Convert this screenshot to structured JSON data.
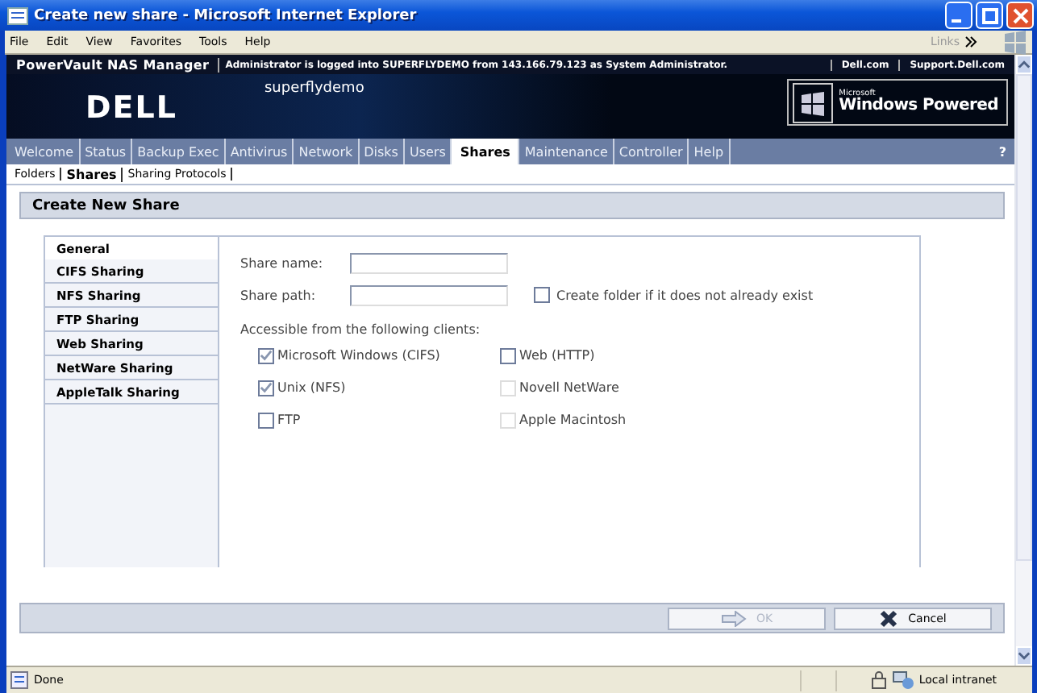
{
  "window": {
    "title": "Create new share - Microsoft Internet Explorer"
  },
  "menu": [
    "File",
    "Edit",
    "View",
    "Favorites",
    "Tools",
    "Help"
  ],
  "links_label": "Links",
  "header": {
    "app_name": "PowerVault NAS Manager",
    "login_message": "Administrator is logged into SUPERFLYDEMO from 143.166.79.123 as System Administrator.",
    "links": [
      "Dell.com",
      "Support.Dell.com"
    ]
  },
  "banner": {
    "logo": "DELL",
    "hostname": "superflydemo",
    "badge_top": "Microsoft",
    "badge_main": "Windows Powered"
  },
  "tabs": [
    {
      "label": "Welcome",
      "selected": false
    },
    {
      "label": "Status",
      "selected": false
    },
    {
      "label": "Backup Exec",
      "selected": false
    },
    {
      "label": "Antivirus",
      "selected": false
    },
    {
      "label": "Network",
      "selected": false
    },
    {
      "label": "Disks",
      "selected": false
    },
    {
      "label": "Users",
      "selected": false
    },
    {
      "label": "Shares",
      "selected": true
    },
    {
      "label": "Maintenance",
      "selected": false
    },
    {
      "label": "Controller",
      "selected": false
    },
    {
      "label": "Help",
      "selected": false
    }
  ],
  "help_mark": "?",
  "subtabs": [
    {
      "label": "Folders",
      "selected": false
    },
    {
      "label": "Shares",
      "selected": true
    },
    {
      "label": "Sharing Protocols",
      "selected": false
    }
  ],
  "page_title": "Create New Share",
  "side_tabs": [
    {
      "label": "General",
      "selected": true
    },
    {
      "label": "CIFS Sharing",
      "selected": false
    },
    {
      "label": "NFS Sharing",
      "selected": false
    },
    {
      "label": "FTP Sharing",
      "selected": false
    },
    {
      "label": "Web Sharing",
      "selected": false
    },
    {
      "label": "NetWare Sharing",
      "selected": false
    },
    {
      "label": "AppleTalk Sharing",
      "selected": false
    }
  ],
  "fields": [
    {
      "label": "Share name:"
    },
    {
      "label": "Share path:"
    }
  ],
  "create_folder": {
    "label": "Create folder if it does not already exist",
    "checked": false
  },
  "clients_label": "Accessible from the following clients:",
  "clients": [
    {
      "label": "Microsoft Windows (CIFS)",
      "checked": true,
      "disabled": false
    },
    {
      "label": "Web (HTTP)",
      "checked": false,
      "disabled": false
    },
    {
      "label": "Unix (NFS)",
      "checked": true,
      "disabled": false
    },
    {
      "label": "Novell NetWare",
      "checked": false,
      "disabled": true
    },
    {
      "label": "FTP",
      "checked": false,
      "disabled": false
    },
    {
      "label": "Apple Macintosh",
      "checked": false,
      "disabled": true
    }
  ],
  "buttons": [
    {
      "label": "OK",
      "kind": "ok",
      "disabled": true
    },
    {
      "label": "Cancel",
      "kind": "cancel",
      "disabled": false
    }
  ],
  "status_bar": {
    "text": "Done",
    "zone": "Local intranet"
  }
}
